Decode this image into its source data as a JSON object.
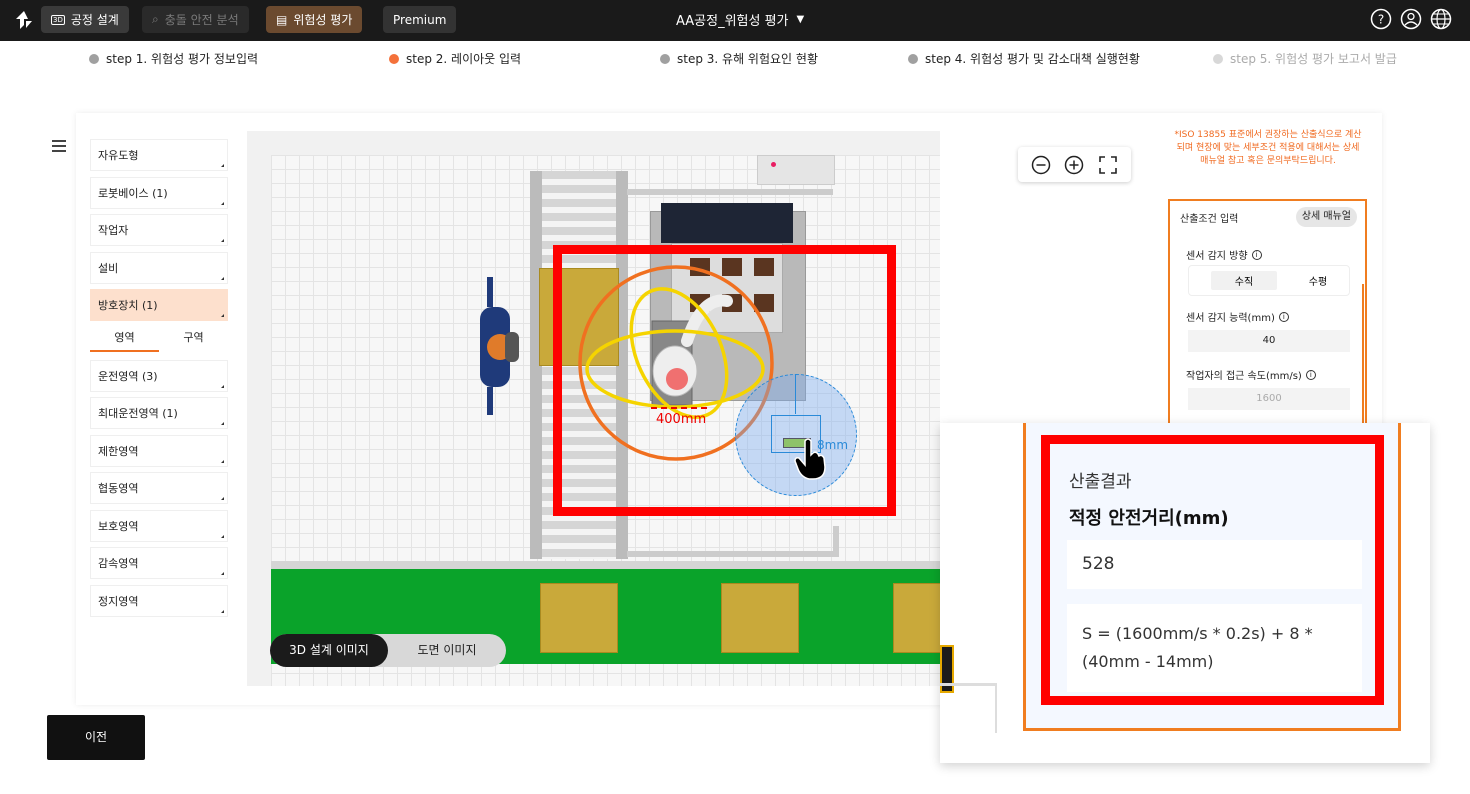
{
  "header": {
    "tabs": [
      {
        "label": "공정 설계",
        "icon": "3d-icon"
      },
      {
        "label": "충돌 안전 분석",
        "icon": "search-icon"
      },
      {
        "label": "위험성 평가",
        "icon": "document-icon"
      },
      {
        "label": "Premium"
      }
    ],
    "project_title": "AA공정_위험성 평가",
    "icons": [
      "help-icon",
      "user-icon",
      "globe-icon"
    ]
  },
  "steps": [
    {
      "label": "step 1. 위험성 평가 정보입력",
      "color": "#a0a0a0"
    },
    {
      "label": "step 2. 레이아웃 입력",
      "color": "#f4713a"
    },
    {
      "label": "step 3. 유해 위험요인 현황",
      "color": "#a0a0a0"
    },
    {
      "label": "step 4. 위험성 평가 및 감소대책 실행현황",
      "color": "#a0a0a0"
    },
    {
      "label": "step 5. 위험성 평가 보고서 발급",
      "color": "#d8d8d8"
    }
  ],
  "sidebar": {
    "items_top": [
      "자유도형",
      "로봇베이스 (1)",
      "작업자",
      "설비",
      "방호장치 (1)"
    ],
    "subtabs": [
      "영역",
      "구역"
    ],
    "items_bottom": [
      "운전영역 (3)",
      "최대운전영역 (1)",
      "제한영역",
      "협동영역",
      "보호영역",
      "감속영역",
      "정지영역"
    ]
  },
  "canvas": {
    "distance_label_1": "400mm",
    "distance_label_2": "8mm",
    "view_toggle": [
      "3D 설계 이미지",
      "도면 이미지"
    ]
  },
  "right_panel": {
    "iso_note": "*ISO 13855 표준에서 권장하는 산출식으로 계산되며 현장에 맞는 세부조건 적용에 대해서는 상세 매뉴얼 참고 혹은 문의부탁드립니다.",
    "calc_title": "산출조건 입력",
    "manual_button": "상세 매뉴얼",
    "sensor_direction_label": "센서 감지 방향",
    "sensor_direction_options": [
      "수직",
      "수평"
    ],
    "sensor_capacity_label": "센서 감지 능력(mm)",
    "sensor_capacity_value": "40",
    "approach_speed_label": "작업자의 접근 속도(mm/s)",
    "approach_speed_value": "1600"
  },
  "result": {
    "title": "산출결과",
    "subtitle": "적정 안전거리(mm)",
    "value": "528",
    "formula": "S = (1600mm/s * 0.2s) + 8 * (40mm - 14mm)"
  },
  "footer": {
    "prev_button": "이전"
  },
  "colors": {
    "accent": "#f07d20",
    "highlight": "#ff0000",
    "active_tab": "#6b4a2f",
    "belt": "#0aa32a"
  }
}
